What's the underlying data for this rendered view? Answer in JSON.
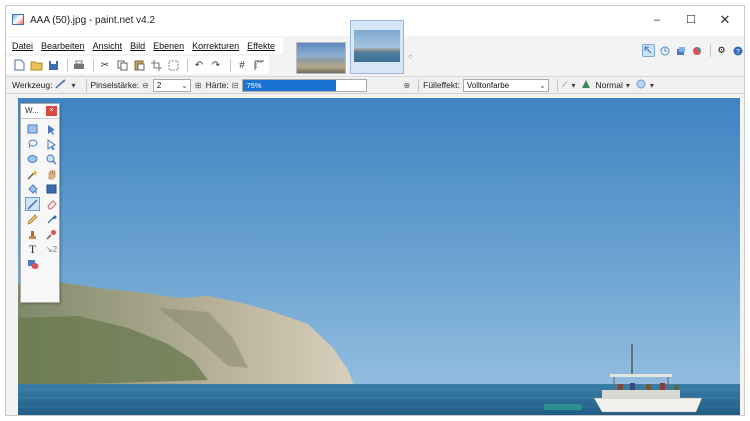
{
  "window": {
    "title": "AAA (50).jpg - paint.net v4.2",
    "minimize": "–",
    "maximize": "☐",
    "close": "✕"
  },
  "menu": [
    "Datei",
    "Bearbeiten",
    "Ansicht",
    "Bild",
    "Ebenen",
    "Korrekturen",
    "Effekte"
  ],
  "toolbar": {
    "icons": [
      "new-file-icon",
      "open-folder-icon",
      "save-icon",
      "print-icon",
      "cut-icon",
      "copy-icon",
      "paste-icon",
      "crop-icon",
      "deselect-icon",
      "undo-icon",
      "redo-icon",
      "grid-icon",
      "ruler-icon"
    ]
  },
  "thumbnails": {
    "close_glyph": "○"
  },
  "right_icons": [
    "tools-window-icon",
    "history-icon",
    "layers-icon",
    "colors-icon",
    "settings-icon",
    "help-icon"
  ],
  "options": {
    "tool_label": "Werkzeug:",
    "brush_width_label": "Pinselstärke:",
    "brush_width_value": "2",
    "hardness_label": "Härte:",
    "hardness_value": "75%",
    "hardness_fraction": 0.75,
    "fill_label": "Fülleffekt:",
    "fill_value": "Volltonfarbe",
    "blend_value": "Normal"
  },
  "tools_panel": {
    "title": "W...",
    "close": "×"
  },
  "colors": {
    "accent": "#1a73d4",
    "close_red": "#e04848",
    "sky": "#5f97c8",
    "sea": "#2f6f98"
  }
}
